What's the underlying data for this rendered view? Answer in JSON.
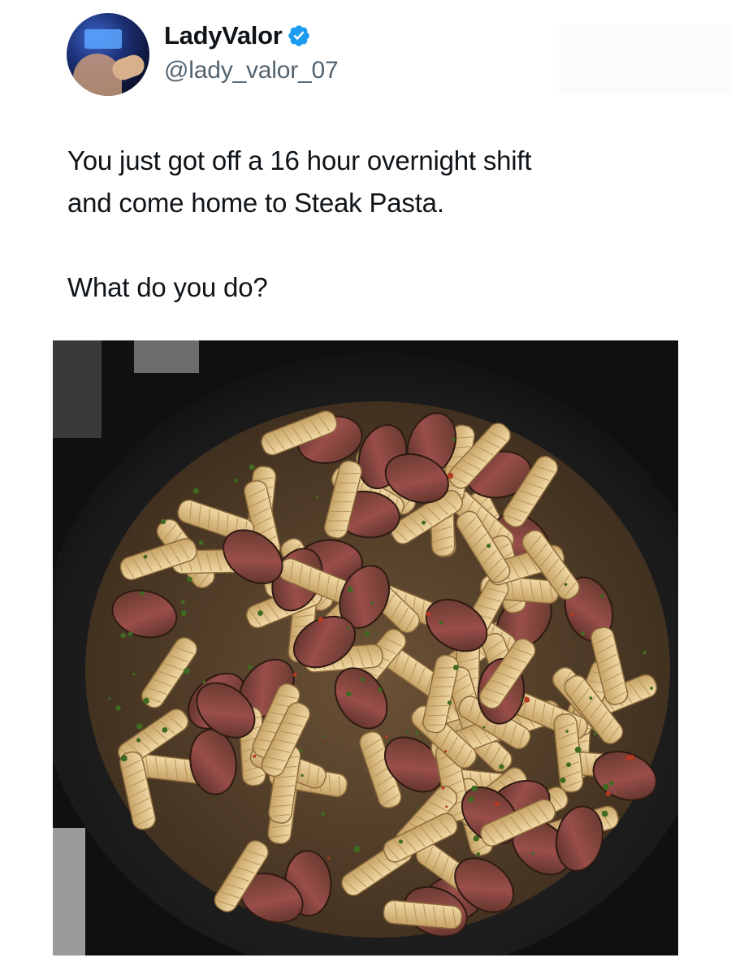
{
  "user": {
    "display_name": "LadyValor",
    "handle": "@lady_valor_07",
    "verified": true,
    "verified_icon": "verified-badge-icon",
    "verified_color": "#1d9bf0"
  },
  "tweet": {
    "lines": [
      "You just got off a 16 hour overnight shift",
      "and come home to Steak Pasta."
    ],
    "question": "What do you do?"
  },
  "media": {
    "type": "photo"
  },
  "colors": {
    "text": "#0f1419",
    "secondary": "#536471",
    "background": "#ffffff"
  }
}
